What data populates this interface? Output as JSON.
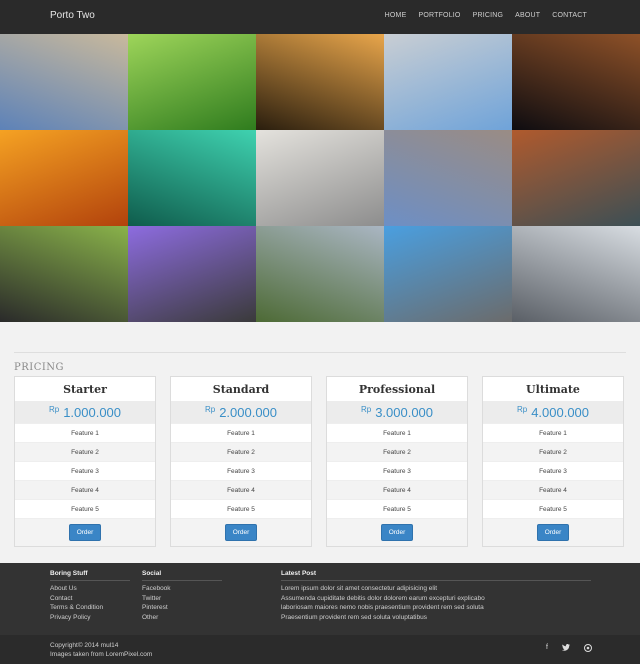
{
  "navbar": {
    "brand": "Porto Two",
    "links": [
      "HOME",
      "PORTFOLIO",
      "PRICING",
      "ABOUT",
      "CONTACT"
    ]
  },
  "gallery": {
    "tiles": [
      {
        "icon": "brandenburg-gate-photo",
        "colors": [
          "#5d82b8",
          "#c9b99c"
        ]
      },
      {
        "icon": "grass-photo",
        "colors": [
          "#2f7c1e",
          "#9ed55a"
        ]
      },
      {
        "icon": "silhouette-photo",
        "colors": [
          "#2a1e0e",
          "#e9a64b"
        ]
      },
      {
        "icon": "airplane-photo",
        "colors": [
          "#6fa3d9",
          "#c9ced3"
        ]
      },
      {
        "icon": "night-city-photo",
        "colors": [
          "#0e0c10",
          "#8e5128"
        ]
      },
      {
        "icon": "sunset-sea-photo",
        "colors": [
          "#b2420c",
          "#f5a223"
        ]
      },
      {
        "icon": "surfer-photo",
        "colors": [
          "#0f5c4c",
          "#3fd2b0"
        ]
      },
      {
        "icon": "small-plane-photo",
        "colors": [
          "#8d8d8d",
          "#e4e2dd"
        ]
      },
      {
        "icon": "skyline-photo",
        "colors": [
          "#6d8fc5",
          "#9a8c84"
        ]
      },
      {
        "icon": "rocky-coast-photo",
        "colors": [
          "#3c4f55",
          "#b05a2d"
        ]
      },
      {
        "icon": "cyclist-photo",
        "colors": [
          "#2a2a2a",
          "#8ab34a"
        ]
      },
      {
        "icon": "sports-car-photo",
        "colors": [
          "#3a3a3a",
          "#8d6ce0"
        ]
      },
      {
        "icon": "train-mountains-photo",
        "colors": [
          "#4d6a35",
          "#aab6c3"
        ]
      },
      {
        "icon": "mini-car-photo",
        "colors": [
          "#6b6b6b",
          "#4a9fe0"
        ]
      },
      {
        "icon": "bullet-train-photo",
        "colors": [
          "#5a5f66",
          "#d8dde2"
        ]
      }
    ]
  },
  "pricing": {
    "title": "PRICING",
    "plans": [
      {
        "name": "Starter",
        "currency": "Rp",
        "price": "1.000.000",
        "features": [
          "Feature 1",
          "Feature 2",
          "Feature 3",
          "Feature 4",
          "Feature 5"
        ],
        "button": "Order"
      },
      {
        "name": "Standard",
        "currency": "Rp",
        "price": "2.000.000",
        "features": [
          "Feature 1",
          "Feature 2",
          "Feature 3",
          "Feature 4",
          "Feature 5"
        ],
        "button": "Order"
      },
      {
        "name": "Professional",
        "currency": "Rp",
        "price": "3.000.000",
        "features": [
          "Feature 1",
          "Feature 2",
          "Feature 3",
          "Feature 4",
          "Feature 5"
        ],
        "button": "Order"
      },
      {
        "name": "Ultimate",
        "currency": "Rp",
        "price": "4.000.000",
        "features": [
          "Feature 1",
          "Feature 2",
          "Feature 3",
          "Feature 4",
          "Feature 5"
        ],
        "button": "Order"
      }
    ]
  },
  "footer": {
    "boring": {
      "title": "Boring Stuff",
      "links": [
        "About Us",
        "Contact",
        "Terms & Condition",
        "Privacy Policy"
      ]
    },
    "social": {
      "title": "Social",
      "links": [
        "Facebook",
        "Twitter",
        "Pinterest",
        "Other"
      ]
    },
    "latest": {
      "title": "Latest Post",
      "lines": [
        "Lorem ipsum dolor sit amet consectetur adipisicing elit",
        "Assumenda cupiditate debitis dolor dolorem earum excepturi explicabo",
        "laboriosam maiores nemo nobis praesentium provident rem sed soluta",
        "Praesentium provident rem sed soluta voluptatibus"
      ]
    },
    "copyright": "Copyright© 2014 mul14",
    "credit": "Images taken from LoremPixel.com",
    "social_icons": [
      "facebook-icon",
      "twitter-icon",
      "github-icon"
    ]
  }
}
